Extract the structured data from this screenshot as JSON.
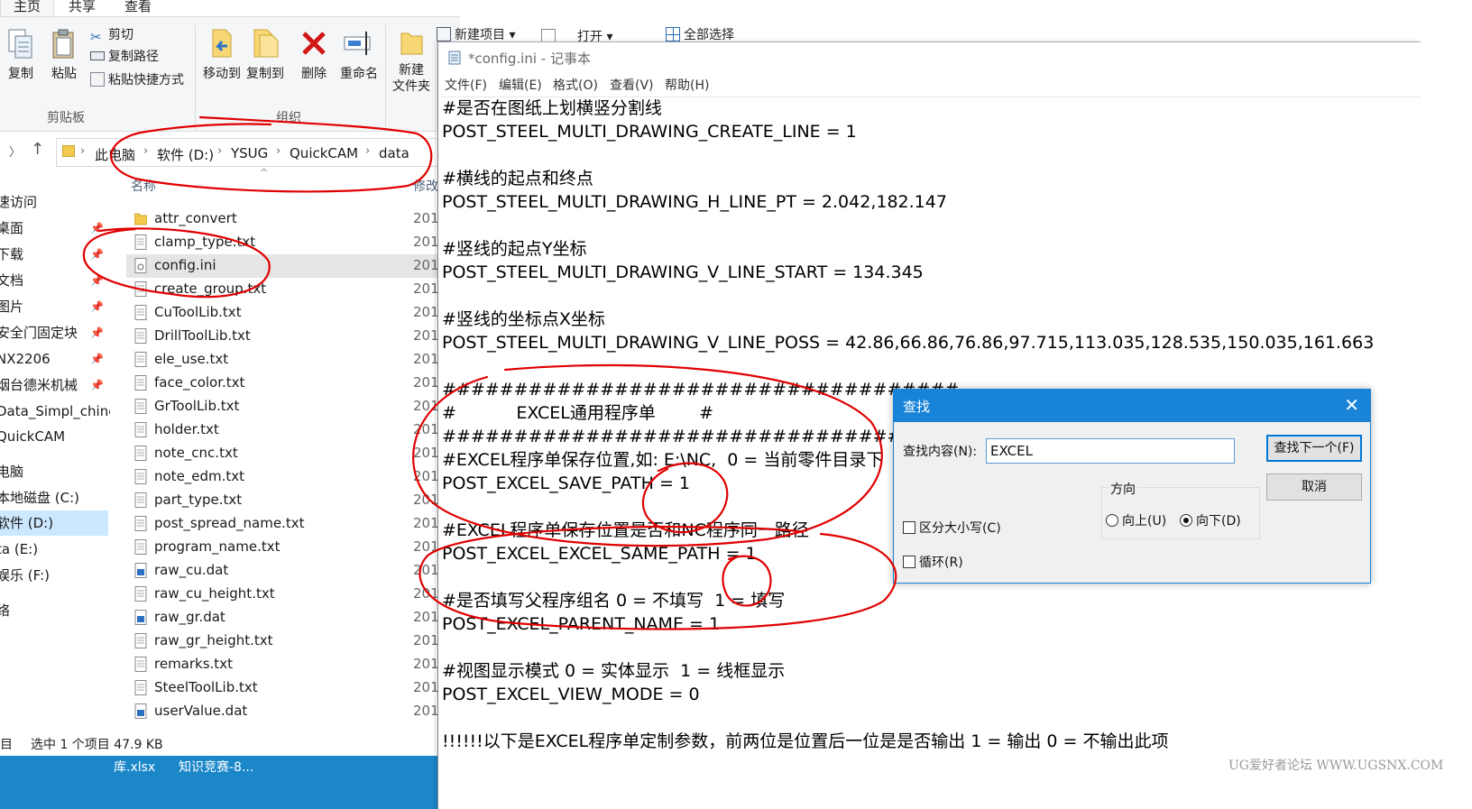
{
  "explorer": {
    "ribbon_tabs": [
      "主页",
      "共享",
      "查看"
    ],
    "clipboard": {
      "copy": "复制",
      "paste": "粘贴",
      "cut": "剪切",
      "copy_path": "复制路径",
      "paste_shortcut": "粘贴快捷方式",
      "group_label": "剪贴板"
    },
    "organize": {
      "move_to": "移动到",
      "copy_to": "复制到",
      "delete": "删除",
      "rename": "重命名",
      "group_label": "组织"
    },
    "new": {
      "new_folder_line1": "新建",
      "new_folder_line2": "文件夹",
      "new_item": "新建项目 ▾"
    },
    "open": {
      "label": "打开 ▾"
    },
    "select": {
      "select_all": "全部选择"
    },
    "breadcrumb": [
      "此电脑",
      "软件 (D:)",
      "YSUG",
      "QuickCAM",
      "data"
    ],
    "columns": {
      "name": "名称",
      "modified": "修改"
    },
    "nav_items": [
      {
        "label": "速访问",
        "pinned": false
      },
      {
        "label": "桌面",
        "pinned": true
      },
      {
        "label": "下载",
        "pinned": true
      },
      {
        "label": "文档",
        "pinned": true
      },
      {
        "label": "图片",
        "pinned": true
      },
      {
        "label": "安全门固定块",
        "pinned": true
      },
      {
        "label": "NX2206",
        "pinned": true
      },
      {
        "label": "烟台德米机械",
        "pinned": true
      },
      {
        "label": "Data_Simpl_chines",
        "pinned": false
      },
      {
        "label": "QuickCAM",
        "pinned": false
      },
      {
        "label": "电脑",
        "pinned": false
      },
      {
        "label": "本地磁盘 (C:)",
        "pinned": false
      },
      {
        "label": "软件 (D:)",
        "pinned": false
      },
      {
        "label": "ta (E:)",
        "pinned": false
      },
      {
        "label": "娱乐 (F:)",
        "pinned": false
      },
      {
        "label": "络",
        "pinned": false
      }
    ],
    "files": [
      {
        "name": "attr_convert",
        "type": "folder",
        "date": "201"
      },
      {
        "name": "clamp_type.txt",
        "type": "txt",
        "date": "201"
      },
      {
        "name": "config.ini",
        "type": "ini",
        "date": "201",
        "selected": true
      },
      {
        "name": "create_group.txt",
        "type": "txt",
        "date": "201"
      },
      {
        "name": "CuToolLib.txt",
        "type": "txt",
        "date": "201"
      },
      {
        "name": "DrillToolLib.txt",
        "type": "txt",
        "date": "201"
      },
      {
        "name": "ele_use.txt",
        "type": "txt",
        "date": "201"
      },
      {
        "name": "face_color.txt",
        "type": "txt",
        "date": "201"
      },
      {
        "name": "GrToolLib.txt",
        "type": "txt",
        "date": "201"
      },
      {
        "name": "holder.txt",
        "type": "txt",
        "date": "201"
      },
      {
        "name": "note_cnc.txt",
        "type": "txt",
        "date": "201"
      },
      {
        "name": "note_edm.txt",
        "type": "txt",
        "date": "201"
      },
      {
        "name": "part_type.txt",
        "type": "txt",
        "date": "201"
      },
      {
        "name": "post_spread_name.txt",
        "type": "txt",
        "date": "201"
      },
      {
        "name": "program_name.txt",
        "type": "txt",
        "date": "201"
      },
      {
        "name": "raw_cu.dat",
        "type": "dat",
        "date": "201"
      },
      {
        "name": "raw_cu_height.txt",
        "type": "txt",
        "date": "201"
      },
      {
        "name": "raw_gr.dat",
        "type": "dat",
        "date": "201"
      },
      {
        "name": "raw_gr_height.txt",
        "type": "txt",
        "date": "201"
      },
      {
        "name": "remarks.txt",
        "type": "txt",
        "date": "201"
      },
      {
        "name": "SteelToolLib.txt",
        "type": "txt",
        "date": "201"
      },
      {
        "name": "userValue.dat",
        "type": "dat",
        "date": "201"
      }
    ],
    "status": {
      "left": "目",
      "selection": "选中 1 个项目  47.9 KB"
    },
    "taskbar": [
      "库.xlsx",
      "知识竞赛-8..."
    ]
  },
  "notepad": {
    "title": "*config.ini - 记事本",
    "menu": [
      "文件(F)",
      "编辑(E)",
      "格式(O)",
      "查看(V)",
      "帮助(H)"
    ],
    "lines": [
      "#是否在图纸上划横竖分割线",
      "POST_STEEL_MULTI_DRAWING_CREATE_LINE = 1",
      "",
      "#横线的起点和终点",
      "POST_STEEL_MULTI_DRAWING_H_LINE_PT = 2.042,182.147",
      "",
      "#竖线的起点Y坐标",
      "POST_STEEL_MULTI_DRAWING_V_LINE_START = 134.345",
      "",
      "#竖线的坐标点X坐标",
      "POST_STEEL_MULTI_DRAWING_V_LINE_POSS = 42.86,66.86,76.86,97.715,113.035,128.535,150.035,161.663",
      "",
      "####################################",
      "#           EXCEL通用程序单        #",
      "####################################",
      "#EXCEL程序单保存位置,如: E:\\NC,  0 = 当前零件目录下",
      "POST_EXCEL_SAVE_PATH = 1",
      "",
      "#EXCEL程序单保存位置是否和NC程序同一路径",
      "POST_EXCEL_EXCEL_SAME_PATH = 1",
      "",
      "#是否填写父程序组名 0 = 不填写  1 = 填写",
      "POST_EXCEL_PARENT_NAME = 1",
      "",
      "#视图显示模式 0 = 实体显示  1 = 线框显示",
      "POST_EXCEL_VIEW_MODE = 0",
      "",
      "!!!!!!以下是EXCEL程序单定制参数，前两位是位置后一位是是否输出 1 = 输出 0 = 不输出此项"
    ]
  },
  "find_dialog": {
    "title": "查找",
    "find_label": "查找内容(N):",
    "find_value": "EXCEL",
    "find_next": "查找下一个(F)",
    "cancel": "取消",
    "direction_label": "方向",
    "up": "向上(U)",
    "down": "向下(D)",
    "direction_selected": "down",
    "match_case": "区分大小写(C)",
    "wrap": "循环(R)"
  },
  "watermark": "UG爱好者论坛 WWW.UGSNX.COM",
  "colors": {
    "accent": "#1883d7",
    "taskbar": "#1b87c9",
    "selection": "#cce8ff",
    "annotation": "#e00000"
  }
}
